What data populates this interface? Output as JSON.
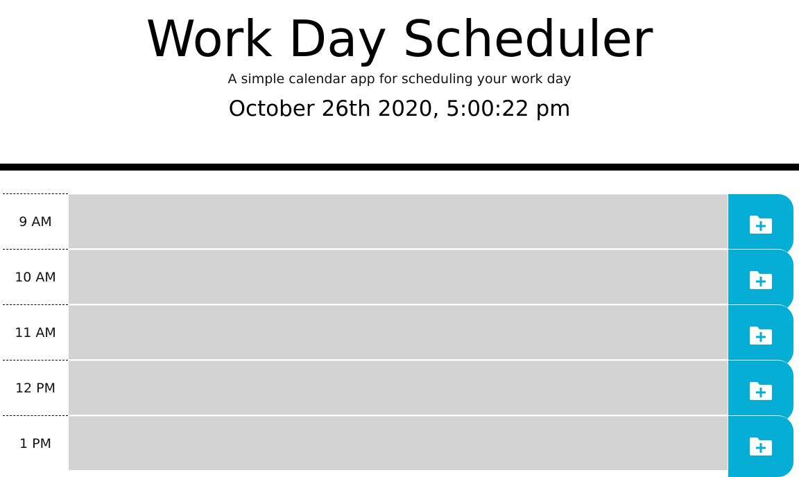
{
  "header": {
    "title": "Work Day Scheduler",
    "subtitle": "A simple calendar app for scheduling your work day",
    "current_day": "October 26th 2020, 5:00:22 pm"
  },
  "colors": {
    "task_background": "#d3d3d3",
    "save_button": "#06AED5",
    "divider": "#000000"
  },
  "timeblocks": [
    {
      "hour": "9 AM",
      "task": "",
      "save_icon": "folder-plus-icon"
    },
    {
      "hour": "10 AM",
      "task": "",
      "save_icon": "folder-plus-icon"
    },
    {
      "hour": "11 AM",
      "task": "",
      "save_icon": "folder-plus-icon"
    },
    {
      "hour": "12 PM",
      "task": "",
      "save_icon": "folder-plus-icon"
    },
    {
      "hour": "1 PM",
      "task": "",
      "save_icon": "folder-plus-icon"
    }
  ]
}
